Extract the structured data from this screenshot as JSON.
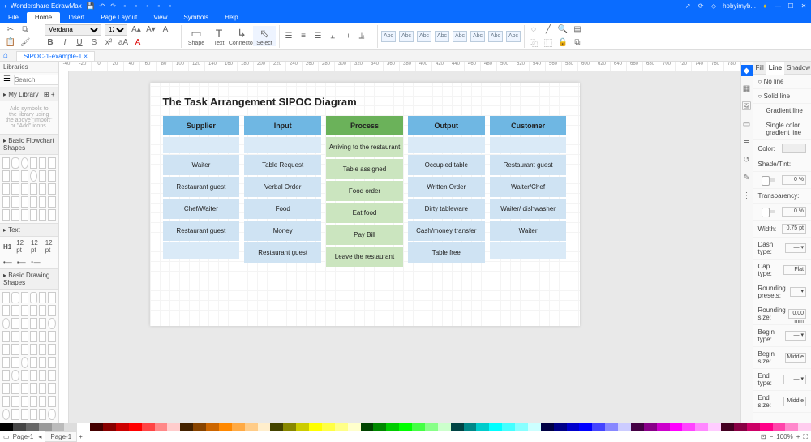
{
  "app": {
    "title": "Wondershare EdrawMax",
    "user": "hobyimyb..."
  },
  "menu": {
    "tabs": [
      "File",
      "Home",
      "Insert",
      "Page Layout",
      "View",
      "Symbols",
      "Help"
    ],
    "active": 1
  },
  "ribbon": {
    "font": "Verdana",
    "size": "12",
    "big_buttons": [
      "Shape",
      "Text",
      "Connector",
      "Select"
    ],
    "style_label": "Abc"
  },
  "doctab": "SIPOC-1-example-1",
  "left": {
    "title": "Libraries",
    "search_placeholder": "Search",
    "mylib": "My Library",
    "hint": "Add symbols to the library using the above \"Import\" or \"Add\" icons.",
    "sec1": "Basic Flowchart Shapes",
    "text_title": "Text",
    "text_items": [
      "H1",
      "12 pt",
      "12 pt",
      "12 pt"
    ],
    "sec2": "Basic Drawing Shapes"
  },
  "diagram": {
    "title": "The Task Arrangement SIPOC Diagram",
    "headers": [
      "Supplier",
      "Input",
      "Process",
      "Output",
      "Customer"
    ],
    "rows": [
      [
        "",
        "",
        "Arriving to the restaurant",
        "",
        ""
      ],
      [
        "Waiter",
        "Table Request",
        "Table assigned",
        "Occupied table",
        "Restaurant guest"
      ],
      [
        "Restaurant guest",
        "Verbal Order",
        "Food order",
        "Written Order",
        "Waiter/Chef"
      ],
      [
        "Chef/Waiter",
        "Food",
        "Eat food",
        "Dirty tableware",
        "Waiter/ dishwasher"
      ],
      [
        "Restaurant guest",
        "Money",
        "Pay Bill",
        "Cash/money transfer",
        "Waiter"
      ],
      [
        "",
        "Restaurant guest",
        "Leave the restaurant",
        "Table free",
        ""
      ]
    ]
  },
  "props": {
    "tabs": [
      "Fill",
      "Line",
      "Shadow"
    ],
    "active": 1,
    "items": {
      "noline": "No line",
      "solid": "Solid line",
      "grad": "Gradient line",
      "single": "Single color gradient line",
      "color": "Color:",
      "shade": "Shade/Tint:",
      "trans": "Transparency:",
      "width": "Width:",
      "dash": "Dash type:",
      "cap": "Cap type:",
      "round_p": "Rounding presets:",
      "round_s": "Rounding size:",
      "begin_t": "Begin type:",
      "begin_s": "Begin size:",
      "end_t": "End type:",
      "end_s": "End size:"
    },
    "vals": {
      "shade_pct": "0 %",
      "trans_pct": "0 %",
      "width": "0.75 pt",
      "round": "0.00 mm",
      "cap": "Flat",
      "middle": "Middle"
    }
  },
  "ruler_marks": [
    "-40",
    "-20",
    "0",
    "20",
    "40",
    "60",
    "80",
    "100",
    "120",
    "140",
    "160",
    "180",
    "200",
    "220",
    "240",
    "260",
    "280",
    "300",
    "320",
    "340",
    "360",
    "380",
    "400",
    "420",
    "440",
    "460",
    "480",
    "500",
    "520",
    "540",
    "560",
    "580",
    "600",
    "620",
    "640",
    "660",
    "680",
    "700",
    "720",
    "740",
    "760",
    "780"
  ],
  "colors": [
    "#000",
    "#444",
    "#666",
    "#999",
    "#bbb",
    "#ddd",
    "#fff",
    "#400",
    "#800",
    "#c00",
    "#f00",
    "#f44",
    "#f88",
    "#fcc",
    "#420",
    "#840",
    "#c60",
    "#f80",
    "#fa4",
    "#fc8",
    "#fec",
    "#440",
    "#880",
    "#cc0",
    "#ff0",
    "#ff4",
    "#ff8",
    "#ffc",
    "#040",
    "#080",
    "#0c0",
    "#0f0",
    "#4f4",
    "#8f8",
    "#cfc",
    "#044",
    "#088",
    "#0cc",
    "#0ff",
    "#4ff",
    "#8ff",
    "#cff",
    "#004",
    "#008",
    "#00c",
    "#00f",
    "#44f",
    "#88f",
    "#ccf",
    "#404",
    "#808",
    "#c0c",
    "#f0f",
    "#f4f",
    "#f8f",
    "#fcf",
    "#402",
    "#804",
    "#c06",
    "#f08",
    "#f4a",
    "#f8c",
    "#fce"
  ],
  "status": {
    "page_label": "Page-1",
    "page_tab": "Page-1",
    "zoom": "100%"
  }
}
